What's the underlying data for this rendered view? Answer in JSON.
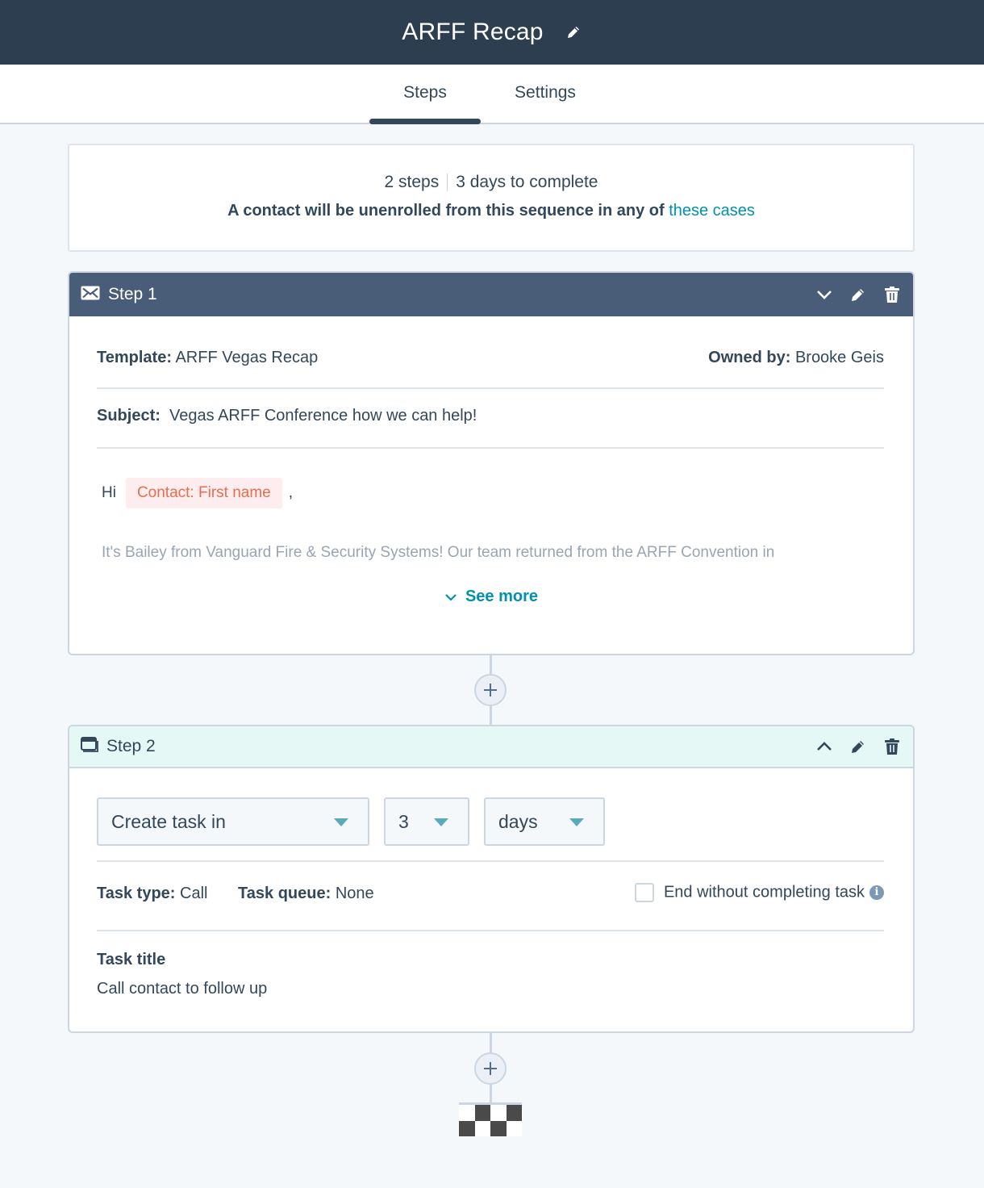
{
  "header": {
    "title": "ARFF Recap",
    "edit_icon": "pencil-icon"
  },
  "tabs": [
    {
      "label": "Steps",
      "active": true
    },
    {
      "label": "Settings",
      "active": false
    }
  ],
  "summary": {
    "steps": "2 steps",
    "duration": "3 days to complete",
    "unenroll_text": "A contact will be unenrolled from this sequence in any of",
    "unenroll_link": "these cases"
  },
  "steps": [
    {
      "label": "Step 1",
      "type_icon": "envelope-icon",
      "collapse_icon": "chevron-down-icon",
      "template_label": "Template:",
      "template_value": "ARFF Vegas Recap",
      "owner_label": "Owned by:",
      "owner_value": "Brooke Geis",
      "subject_label": "Subject:",
      "subject_value": "Vegas ARFF Conference how we can help!",
      "greeting": "Hi",
      "token": "Contact: First name",
      "greeting_punct": ",",
      "body_preview": "It's Bailey from Vanguard Fire & Security Systems! Our team returned from the ARFF Convention in",
      "see_more": "See more"
    },
    {
      "label": "Step 2",
      "type_icon": "task-icon",
      "collapse_icon": "chevron-up-icon",
      "action_select": "Create task in",
      "delay_value": "3",
      "delay_unit": "days",
      "task_type_label": "Task type:",
      "task_type_value": "Call",
      "task_queue_label": "Task queue:",
      "task_queue_value": "None",
      "end_without_label": "End without completing task",
      "end_without_checked": false,
      "task_title_label": "Task title",
      "task_title_value": "Call contact to follow up"
    }
  ],
  "end_marker": "finish-flag-icon"
}
